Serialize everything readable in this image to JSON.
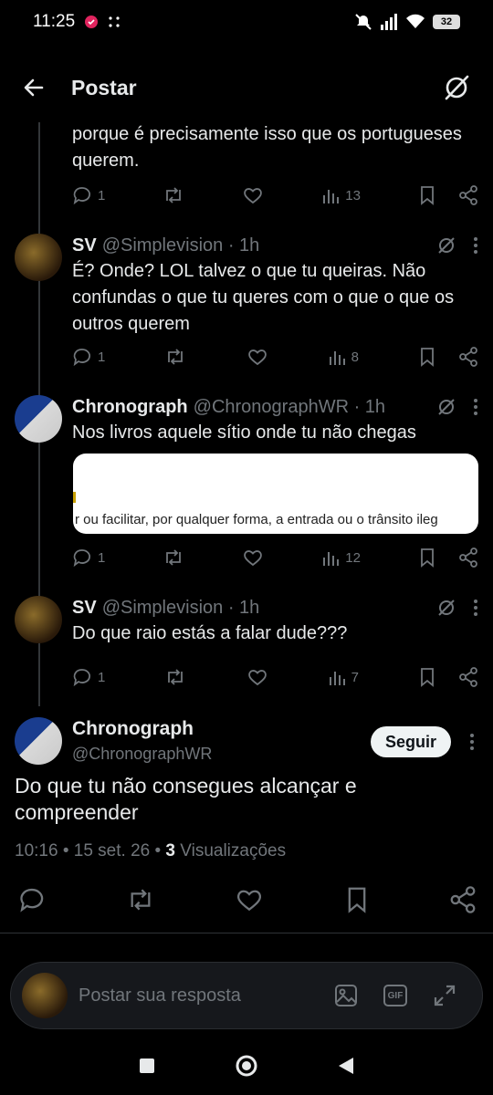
{
  "status": {
    "time": "11:25",
    "battery": "32"
  },
  "header": {
    "title": "Postar"
  },
  "tweets": [
    {
      "text": "porque é precisamente isso que os portugueses querem.",
      "replies": "1",
      "views": "13"
    },
    {
      "name": "SV",
      "handle": "@Simplevision · 1h",
      "text": "É? Onde? LOL talvez o que tu queiras. Não confundas o que tu queres com o que o que os outros querem",
      "replies": "1",
      "views": "8"
    },
    {
      "name": "Chronograph",
      "handle": "@ChronographWR · 1h",
      "text": "Nos livros aquele sítio onde tu não chegas",
      "media_text": "r ou facilitar, por qualquer forma, a entrada ou o trânsito ileg",
      "replies": "1",
      "views": "12"
    },
    {
      "name": "SV",
      "handle": "@Simplevision · 1h",
      "text": "Do que raio estás a falar dude???",
      "replies": "1",
      "views": "7"
    }
  ],
  "main_tweet": {
    "name": "Chronograph",
    "handle": "@ChronographWR",
    "follow_label": "Seguir",
    "text": "Do que tu não consegues alcançar e compreender",
    "time": "10:16 • 15 set. 26 • ",
    "views_count": "3",
    "views_label": " Visualizações"
  },
  "reply_bar": {
    "placeholder": "Postar sua resposta",
    "gif_label": "GIF"
  }
}
